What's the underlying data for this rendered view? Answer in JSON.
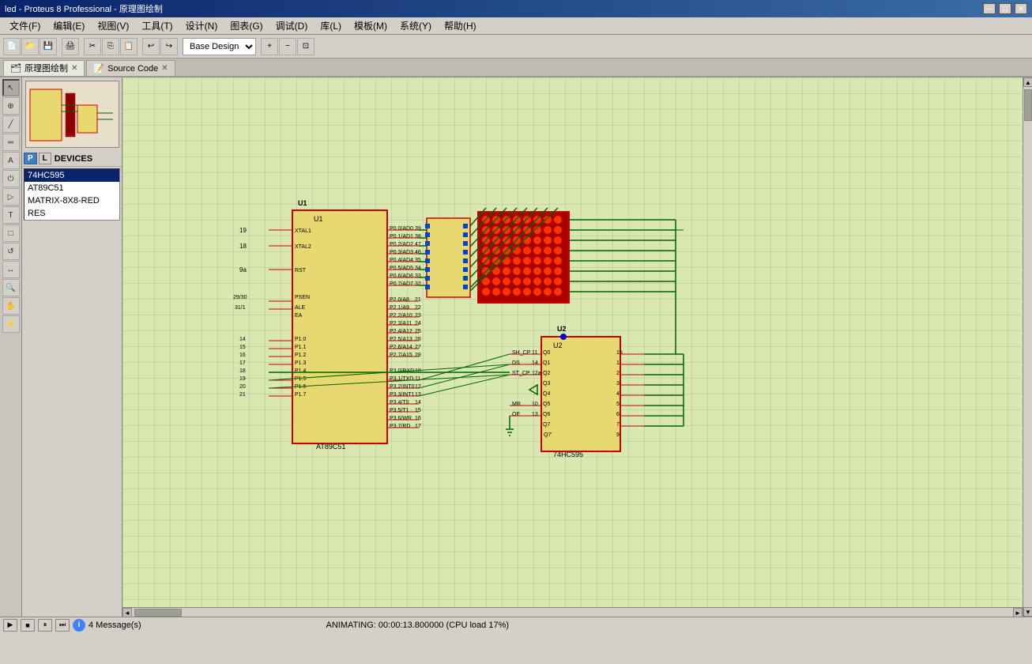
{
  "titlebar": {
    "title": "led - Proteus 8 Professional - 原理图绘制",
    "min_label": "—",
    "max_label": "□",
    "close_label": "✕"
  },
  "menubar": {
    "items": [
      "文件(F)",
      "编辑(E)",
      "视图(V)",
      "工具(T)",
      "设计(N)",
      "图表(G)",
      "调试(D)",
      "库(L)",
      "模板(M)",
      "系统(Y)",
      "帮助(H)"
    ]
  },
  "toolbar": {
    "dropdown_value": "Base Design"
  },
  "tabs": [
    {
      "label": "原理图绘制",
      "active": true,
      "icon": "schematic-icon"
    },
    {
      "label": "Source Code",
      "active": false,
      "icon": "code-icon"
    }
  ],
  "left_panel": {
    "device_header": {
      "p_label": "P",
      "l_label": "L",
      "devices_label": "DEVICES"
    },
    "devices": [
      {
        "name": "74HC595",
        "selected": true
      },
      {
        "name": "AT89C51",
        "selected": false
      },
      {
        "name": "MATRIX-8X8-RED",
        "selected": false
      },
      {
        "name": "RES",
        "selected": false
      }
    ]
  },
  "status": {
    "messages": "4 Message(s)",
    "animating": "ANIMATING: 00:00:13.800000 (CPU load 17%)",
    "info_icon": "i"
  },
  "tools": [
    "↖",
    "→",
    "↙",
    "□",
    "✎",
    "⬡",
    "+",
    "—",
    "~",
    "A",
    "+"
  ],
  "colors": {
    "grid_bg": "#d8e8b0",
    "wire_green": "#006600",
    "component_border": "#cc0000",
    "component_fill": "#e8d880",
    "led_red": "#cc2200",
    "dot_red": "#ff2200",
    "accent_blue": "#0000cc",
    "tab_active_bg": "#e8e8e0"
  }
}
